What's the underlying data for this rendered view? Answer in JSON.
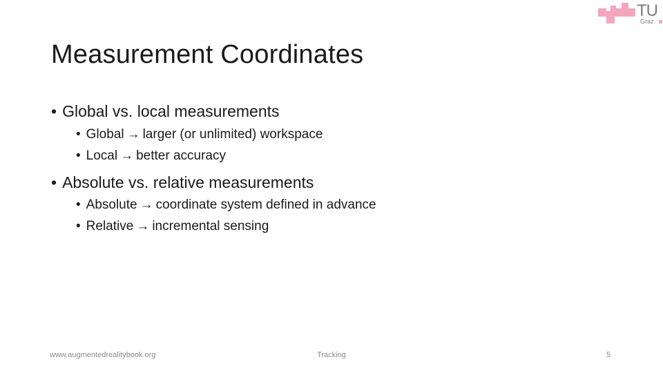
{
  "logo": {
    "name": "TU Graz",
    "main": "TU",
    "sub": "Graz",
    "color": "#f4a6bd"
  },
  "title": "Measurement Coordinates",
  "bullets": [
    {
      "text": "Global vs. local measurements",
      "sub": [
        {
          "left": "Global",
          "right": "larger (or unlimited) workspace"
        },
        {
          "left": "Local",
          "right": "better accuracy"
        }
      ]
    },
    {
      "text": "Absolute vs. relative measurements",
      "sub": [
        {
          "left": "Absolute",
          "right": "coordinate system defined in advance"
        },
        {
          "left": "Relative",
          "right": "incremental sensing"
        }
      ]
    }
  ],
  "glyphs": {
    "bullet": "•",
    "arrow": "→"
  },
  "footer": {
    "url": "www.augmentedrealitybook.org",
    "section": "Tracking",
    "page": "5"
  }
}
